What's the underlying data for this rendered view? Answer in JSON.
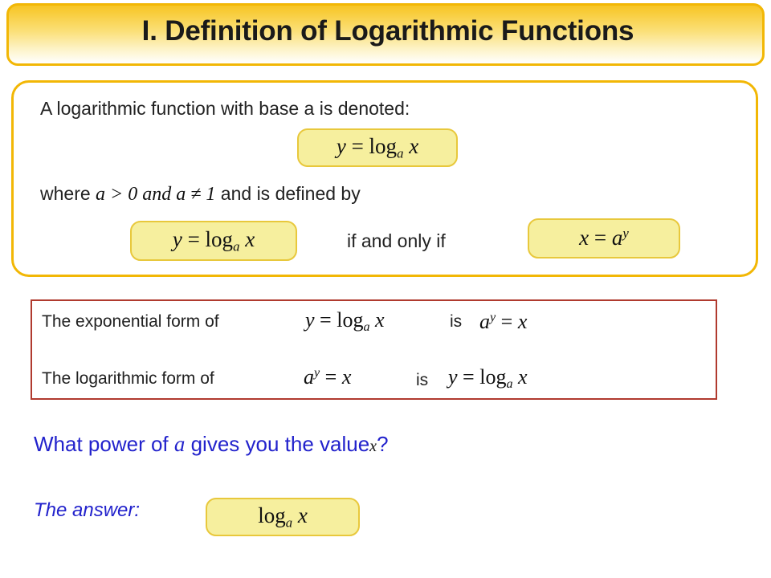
{
  "slide": {
    "title": "I. Definition of Logarithmic Functions",
    "definition": {
      "line1": "A logarithmic function with base a is denoted:",
      "formula1": "y = log_a x",
      "line2_pre": "where ",
      "line2_math": "a > 0 and a ≠ 1",
      "line2_post": " and is defined by",
      "formula2": "y = log_a x",
      "connector": "if and only if",
      "formula3": "x = a^y"
    },
    "forms": {
      "row1_label": "The exponential form of",
      "row1_formula": "y = log_a x",
      "row1_is": "is",
      "row1_result": "a^y = x",
      "row2_label": "The logarithmic form of",
      "row2_formula": "a^y = x",
      "row2_is": "is",
      "row2_result": "y = log_a x"
    },
    "question": {
      "part1": "What power of ",
      "variable": "a",
      "part2": " gives you the value",
      "value": "x",
      "mark": "?"
    },
    "answer": {
      "label": "The answer:",
      "formula": "log_a x"
    },
    "colors": {
      "title_border": "#f2b705",
      "chip_fill": "#f6ef9e",
      "chip_border": "#e8c83c",
      "forms_border": "#b03a2e",
      "blue_text": "#2222cc"
    }
  }
}
